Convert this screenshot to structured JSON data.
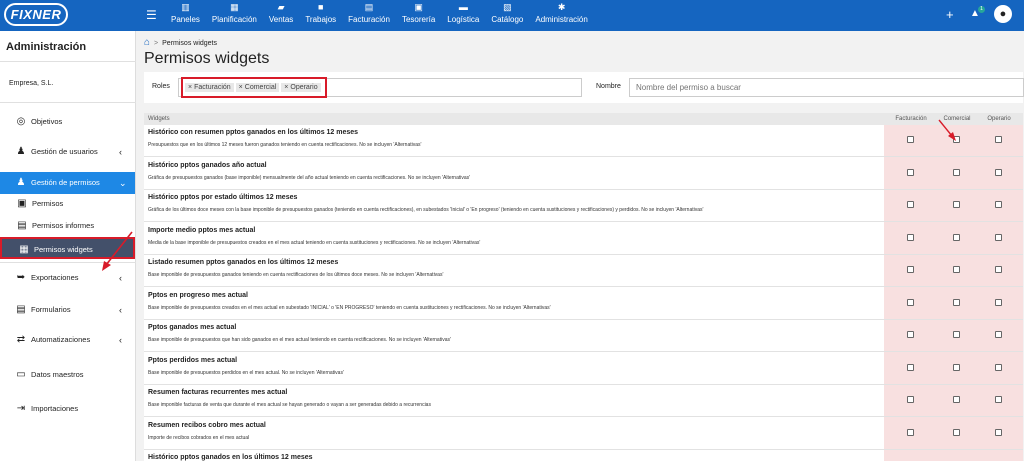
{
  "app": {
    "logo": "FIXNER"
  },
  "topnav": {
    "items": [
      {
        "label": "Paneles",
        "icon": "chart-icon"
      },
      {
        "label": "Planificación",
        "icon": "calendar-icon"
      },
      {
        "label": "Ventas",
        "icon": "cart-icon"
      },
      {
        "label": "Trabajos",
        "icon": "briefcase-icon"
      },
      {
        "label": "Facturación",
        "icon": "document-icon"
      },
      {
        "label": "Tesorería",
        "icon": "money-icon"
      },
      {
        "label": "Logística",
        "icon": "truck-icon"
      },
      {
        "label": "Catálogo",
        "icon": "catalog-icon"
      },
      {
        "label": "Administración",
        "icon": "gear-icon"
      }
    ],
    "notifications_count": "1"
  },
  "sidebar": {
    "title": "Administración",
    "company": "Empresa, S.L.",
    "items": [
      {
        "label": "Objetivos"
      },
      {
        "label": "Gestión de usuarios"
      },
      {
        "label": "Gestión de permisos"
      },
      {
        "label": "Permisos"
      },
      {
        "label": "Permisos informes"
      },
      {
        "label": "Permisos widgets"
      },
      {
        "label": "Exportaciones"
      },
      {
        "label": "Formularios"
      },
      {
        "label": "Automatizaciones"
      },
      {
        "label": "Datos maestros"
      },
      {
        "label": "Importaciones"
      }
    ]
  },
  "breadcrumb": {
    "current": "Permisos widgets"
  },
  "page": {
    "title": "Permisos widgets"
  },
  "filters": {
    "roles_label": "Roles",
    "roles": [
      "Facturación",
      "Comercial",
      "Operario"
    ],
    "name_label": "Nombre",
    "name_placeholder": "Nombre del permiso a buscar"
  },
  "table": {
    "headers": {
      "widgets": "Widgets",
      "col1": "Facturación",
      "col2": "Comercial",
      "col3": "Operario"
    },
    "rows": [
      {
        "title": "Histórico con resumen pptos ganados en los últimos 12 meses",
        "desc": "Presupuestos que en los últimos 12 meses fueron ganados teniendo en cuenta rectificaciones. No se incluyen 'Alternativas'"
      },
      {
        "title": "Histórico pptos ganados año actual",
        "desc": "Gráfica de presupuestos ganados (base imponible) mensualmente del año actual teniendo en cuenta rectificaciones. No se incluyen 'Alternativas'"
      },
      {
        "title": "Histórico pptos por estado últimos 12 meses",
        "desc": "Gráfica de los últimos doce meses con la base imponible de presupuestos ganados (teniendo en cuenta rectificaciones), en subestados 'Inicial' o 'En progreso' (teniendo en cuenta sustituciones y rectificaciones) y perdidos. No se incluyen 'Alternativas'"
      },
      {
        "title": "Importe medio pptos mes actual",
        "desc": "Media de la base imponible de presupuestos creados en el mes actual teniendo en cuenta sustituciones y rectificaciones. No se incluyen 'Alternativas'"
      },
      {
        "title": "Listado resumen pptos ganados en los últimos 12 meses",
        "desc": "Base imponible de presupuestos ganados teniendo en cuenta rectificaciones de los últimos doce meses. No se incluyen 'Alternativas'"
      },
      {
        "title": "Pptos en progreso mes actual",
        "desc": "Base imponible de presupuestos creados en el mes actual en subestado 'INICIAL' o 'EN PROGRESO' teniendo en cuenta sustituciones y rectificaciones. No se incluyen 'Alternativas'"
      },
      {
        "title": "Pptos ganados mes actual",
        "desc": "Base imponible de presupuestos que han sido ganados en el mes actual teniendo en cuenta rectificaciones. No se incluyen 'Alternativas'"
      },
      {
        "title": "Pptos perdidos mes actual",
        "desc": "Base imponible de presupuestos perdidos en el mes actual. No se incluyen 'Alternativas'"
      },
      {
        "title": "Resumen facturas recurrentes mes actual",
        "desc": "Base imponible facturas de venta que durante el mes actual se hayan generado o vayan a ser generadas debido a recurrencias"
      },
      {
        "title": "Resumen recibos cobro mes actual",
        "desc": "Importe de recibos cobrados en el mes actual"
      },
      {
        "title": "Histórico pptos ganados en los últimos 12 meses",
        "desc": ""
      }
    ]
  }
}
